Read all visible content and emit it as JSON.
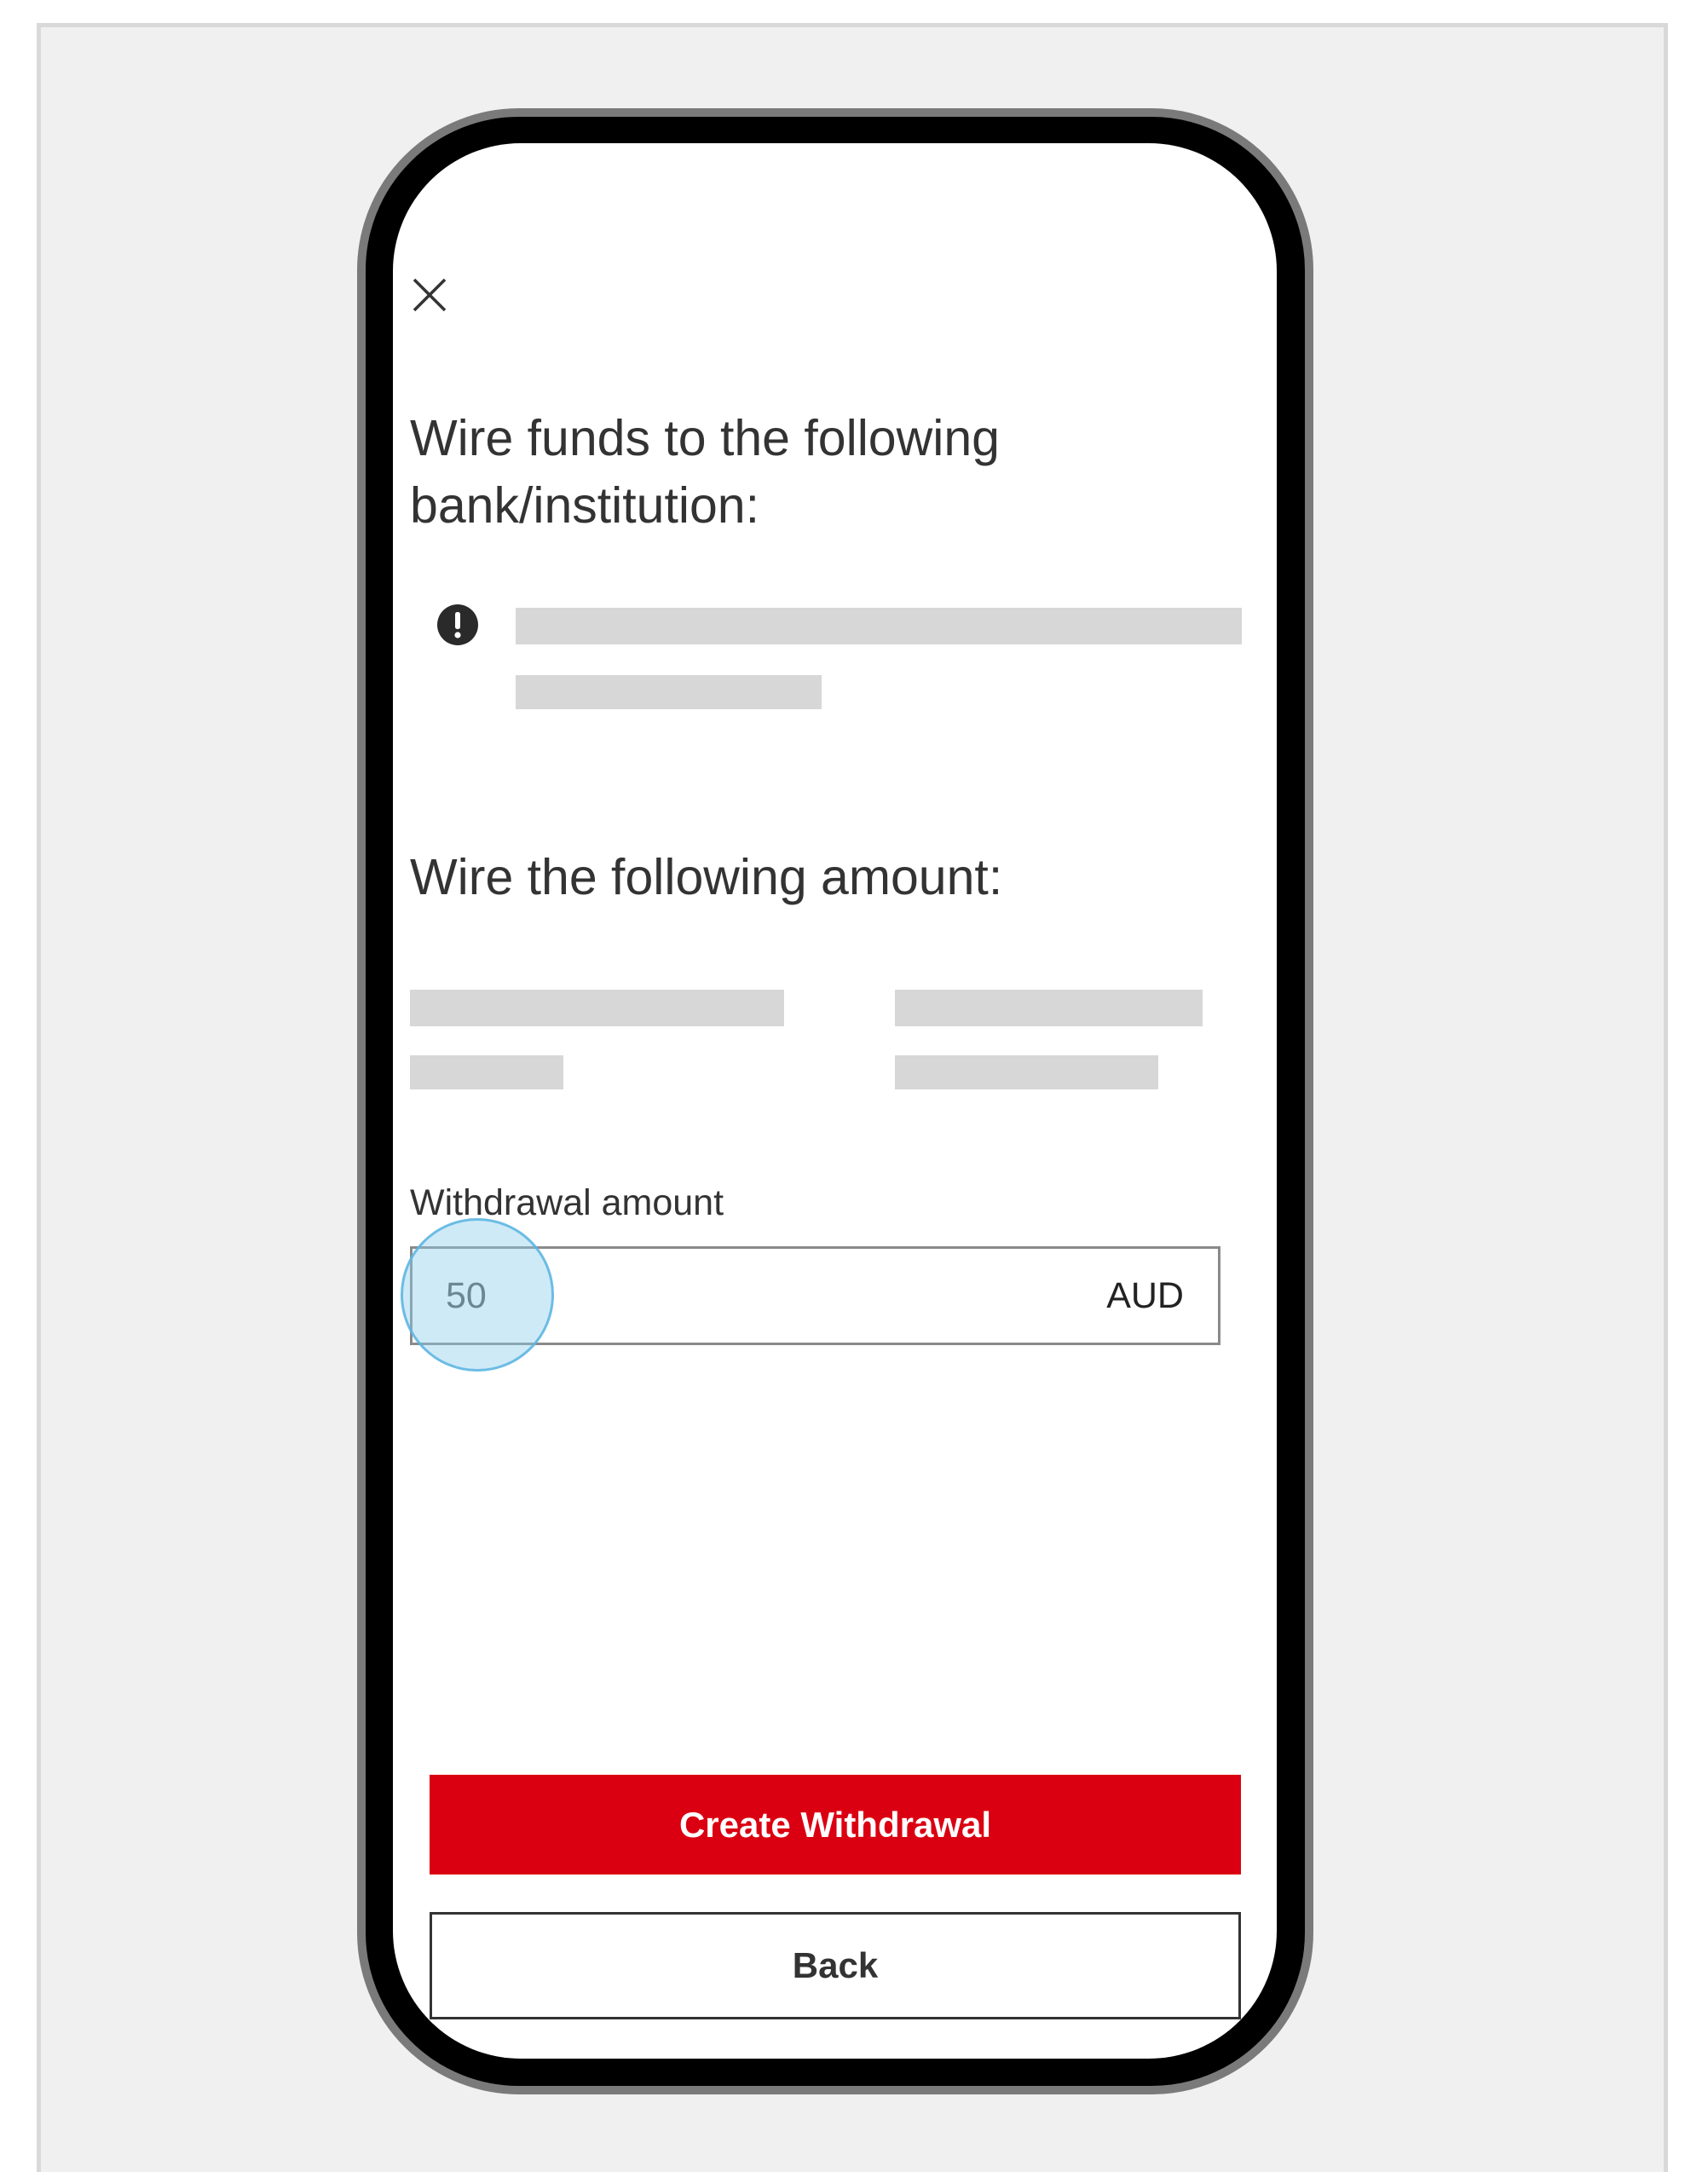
{
  "header": {
    "close_icon": "close-icon"
  },
  "bank_section": {
    "heading": "Wire funds to the following bank/institution:",
    "notice_icon": "exclamation-circle-icon"
  },
  "amount_section": {
    "heading": "Wire the following amount:"
  },
  "withdrawal": {
    "label": "Withdrawal amount",
    "value": "50",
    "currency": "AUD"
  },
  "actions": {
    "primary_label": "Create Withdrawal",
    "secondary_label": "Back"
  },
  "colors": {
    "primary": "#db0011",
    "skeleton": "#d7d7d7",
    "background": "#f0f0f0",
    "touch_indicator": "#8ccdeb"
  }
}
